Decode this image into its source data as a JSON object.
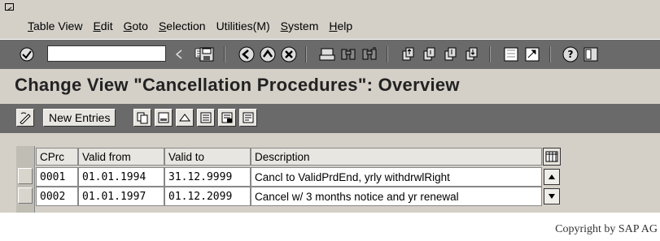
{
  "menu": {
    "items": [
      "Table View",
      "Edit",
      "Goto",
      "Selection",
      "Utilities(M)",
      "System",
      "Help"
    ]
  },
  "toolbar": {
    "command_value": "",
    "icons": [
      "check-icon",
      "back-arrow-icon",
      "save-icon",
      "back-icon",
      "exit-icon",
      "cancel-icon",
      "print-icon",
      "find-icon",
      "find-next-icon",
      "first-page-icon",
      "previous-page-icon",
      "next-page-icon",
      "last-page-icon",
      "create-session-icon",
      "shortcut-icon",
      "help-icon",
      "layout-icon"
    ]
  },
  "title": "Change View \"Cancellation Procedures\": Overview",
  "app_toolbar": {
    "new_entries": "New Entries"
  },
  "table": {
    "columns": [
      "CPrc",
      "Valid from",
      "Valid to",
      "Description"
    ],
    "rows": [
      [
        "0001",
        "01.01.1994",
        "31.12.9999",
        "Cancl to ValidPrdEnd, yrly withdrwlRight"
      ],
      [
        "0002",
        "01.01.1997",
        "01.12.2099",
        "Cancel w/ 3 months notice and yr renewal"
      ]
    ]
  },
  "copyright": "Copyright by SAP AG"
}
